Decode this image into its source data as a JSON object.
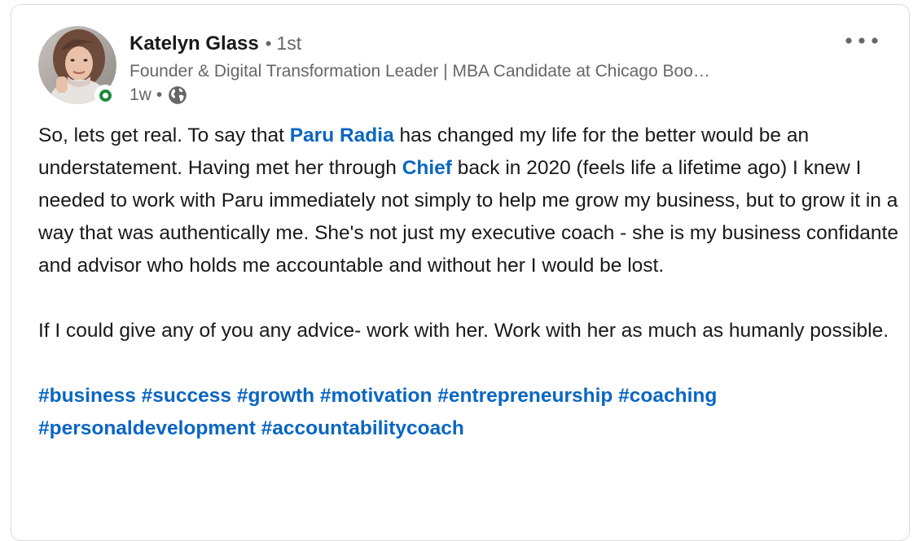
{
  "author": {
    "name": "Katelyn Glass",
    "separator": "•",
    "degree": "1st",
    "headline": "Founder & Digital Transformation Leader | MBA Candidate at Chicago Boo…",
    "time": "1w",
    "meta_separator": "•",
    "visibility_icon": "globe-icon",
    "presence_status": "online",
    "presence_color": "#1e8a3e"
  },
  "menu": {
    "icon": "more-options-icon"
  },
  "post": {
    "p1_a": "So, lets get real. To say that ",
    "mention_1": "Paru Radia",
    "p1_b": " has changed my life for the better would be an understatement. Having met her through ",
    "mention_2": "Chief",
    "p1_c": " back in 2020 (feels life a lifetime ago) I knew I needed to work with Paru immediately not simply to help me grow my business, but to grow it in a way that was authentically me. She's not just my executive coach - she is my business confidante and advisor who holds me accountable and without her I would be lost.",
    "p2": "If I could give any of you any advice- work with her. Work with her as much as humanly possible.",
    "hashtags": [
      "#business",
      "#success",
      "#growth",
      "#motivation",
      "#entrepreneurship",
      "#coaching",
      "#personaldevelopment",
      "#accountabilitycoach"
    ]
  },
  "colors": {
    "link": "#0a66c2",
    "text": "#191919",
    "secondary": "#666666"
  }
}
